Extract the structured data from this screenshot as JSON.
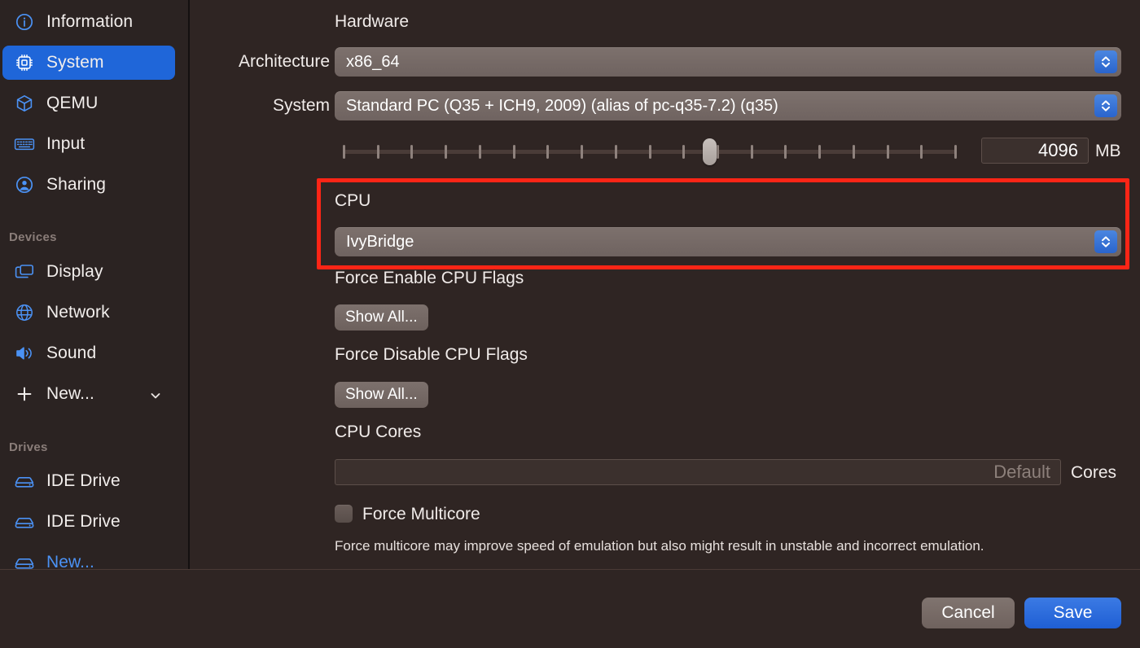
{
  "sidebar": {
    "items": [
      {
        "label": "Information",
        "icon": "info-circle-icon",
        "selected": false
      },
      {
        "label": "System",
        "icon": "cpu-chip-icon",
        "selected": true
      },
      {
        "label": "QEMU",
        "icon": "box-icon",
        "selected": false
      },
      {
        "label": "Input",
        "icon": "keyboard-icon",
        "selected": false
      },
      {
        "label": "Sharing",
        "icon": "person-circle-icon",
        "selected": false
      }
    ],
    "devices_group_label": "Devices",
    "devices": [
      {
        "label": "Display",
        "icon": "display-windows-icon"
      },
      {
        "label": "Network",
        "icon": "globe-icon"
      },
      {
        "label": "Sound",
        "icon": "speaker-icon"
      }
    ],
    "devices_new_label": "New...",
    "drives_group_label": "Drives",
    "drives": [
      {
        "label": "IDE Drive",
        "icon": "drive-icon"
      },
      {
        "label": "IDE Drive",
        "icon": "drive-icon"
      }
    ],
    "drives_new_label": "New..."
  },
  "main": {
    "hardware_title": "Hardware",
    "architecture_label": "Architecture",
    "architecture_value": "x86_64",
    "system_label": "System",
    "system_value": "Standard PC (Q35 + ICH9, 2009) (alias of pc-q35-7.2) (q35)",
    "memory_value": "4096",
    "memory_unit": "MB",
    "memory_slider_percent": 60,
    "memory_slider_ticks": 19,
    "cpu_title": "CPU",
    "cpu_value": "IvyBridge",
    "force_enable_label": "Force Enable CPU Flags",
    "force_enable_button": "Show All...",
    "force_disable_label": "Force Disable CPU Flags",
    "force_disable_button": "Show All...",
    "cpu_cores_label": "CPU Cores",
    "cpu_cores_value": "",
    "cpu_cores_placeholder": "Default",
    "cpu_cores_unit": "Cores",
    "force_multicore_label": "Force Multicore",
    "force_multicore_checked": false,
    "multicore_hint": "Force multicore may improve speed of emulation but also might result in unstable and incorrect emulation."
  },
  "footer": {
    "cancel_label": "Cancel",
    "save_label": "Save"
  },
  "colors": {
    "accent_blue": "#1f66d9",
    "highlight_red": "#fb2516",
    "sidebar_bg": "#2b2322",
    "content_bg": "#2f2523",
    "icon_blue": "#4b92f5"
  }
}
